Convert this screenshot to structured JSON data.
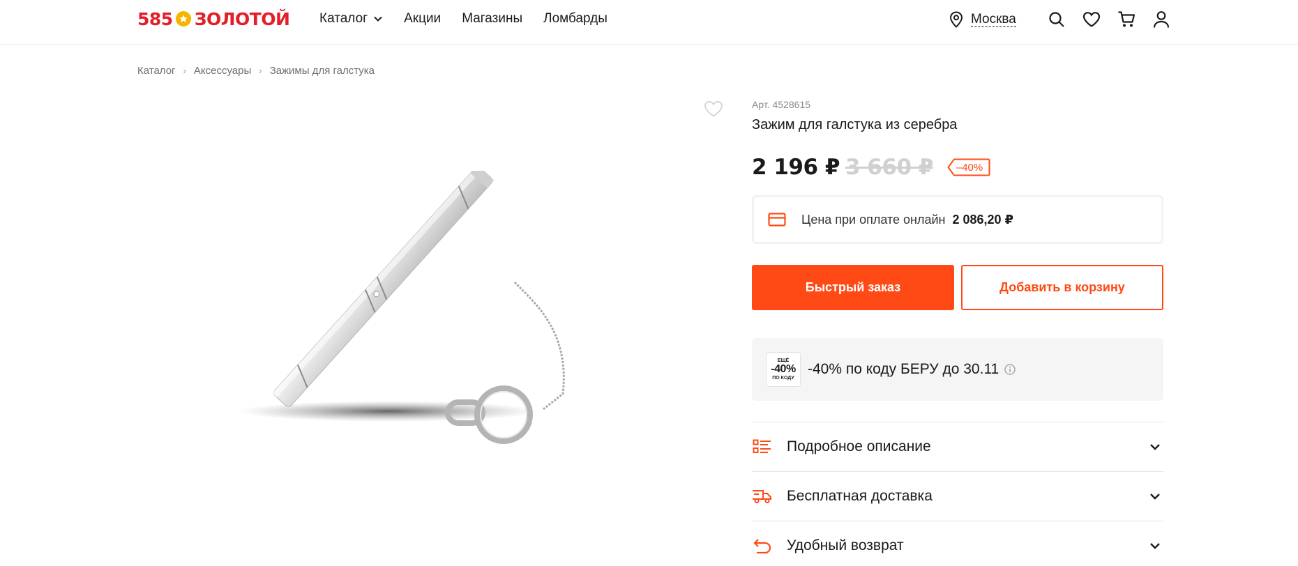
{
  "header": {
    "logo_number": "585",
    "logo_word": "ЗОЛОТОЙ",
    "nav": [
      {
        "label": "Каталог",
        "has_dropdown": true
      },
      {
        "label": "Акции"
      },
      {
        "label": "Магазины"
      },
      {
        "label": "Ломбарды"
      }
    ],
    "city": "Москва",
    "icons": [
      "location-pin-icon",
      "search-icon",
      "heart-icon",
      "cart-icon",
      "user-icon"
    ]
  },
  "breadcrumb": [
    "Каталог",
    "Аксессуары",
    "Зажимы для галстука"
  ],
  "product": {
    "article": "Арт. 4528615",
    "title": "Зажим для галстука из серебра",
    "price": "2 196 ₽",
    "old_price": "3 660 ₽",
    "discount": "–40%",
    "online_price_label": "Цена при оплате онлайн",
    "online_price_value": "2 086,20 ₽"
  },
  "buttons": {
    "quick_order": "Быстрый заказ",
    "add_to_cart": "Добавить в корзину"
  },
  "promo": {
    "badge_top": "ЕЩЁ",
    "badge_main": "-40%",
    "badge_bottom": "ПО КОДУ",
    "text": "-40% по коду БЕРУ до 30.11"
  },
  "accordion": [
    {
      "label": "Подробное описание",
      "icon": "list-icon"
    },
    {
      "label": "Бесплатная доставка",
      "icon": "delivery-truck-icon"
    },
    {
      "label": "Удобный возврат",
      "icon": "return-arrow-icon"
    }
  ],
  "colors": {
    "accent": "#ff4a15",
    "logo_red": "#e41e26",
    "logo_star": "#f5b400"
  }
}
